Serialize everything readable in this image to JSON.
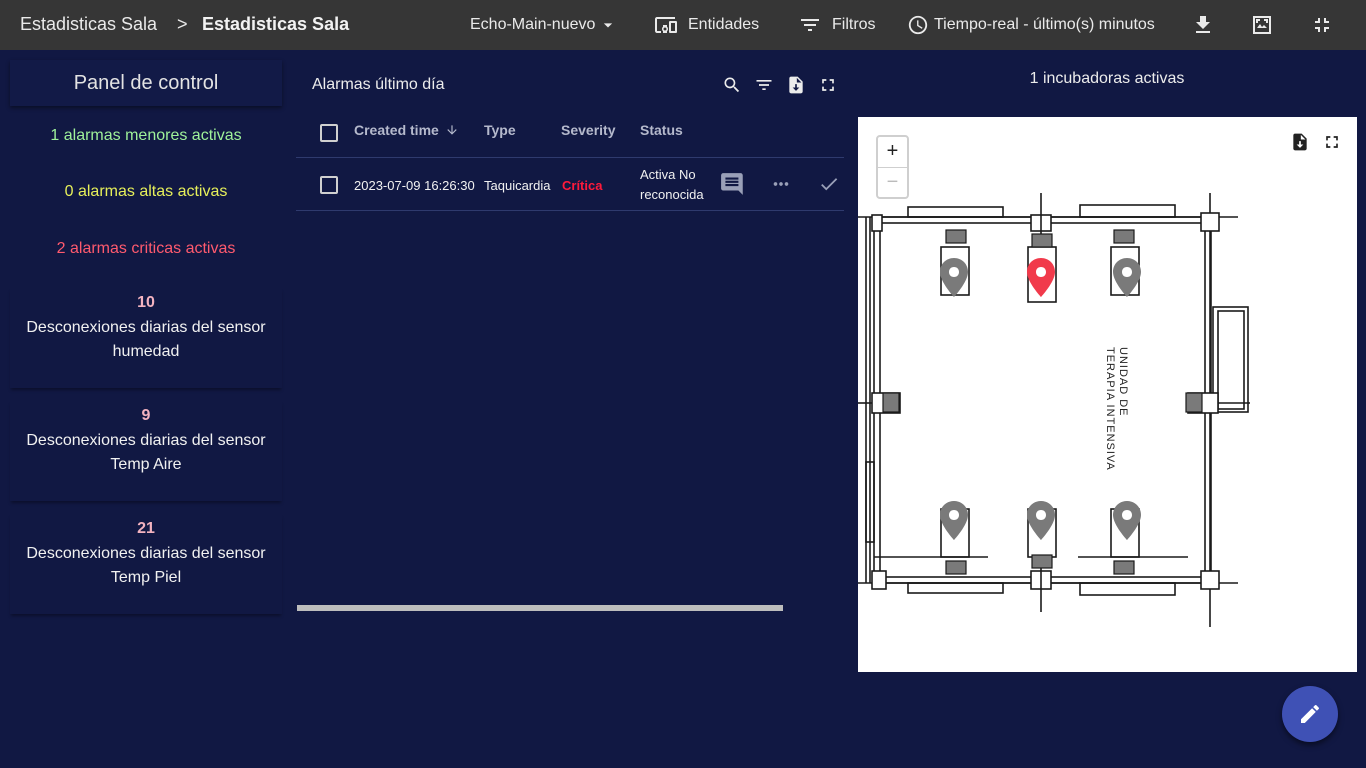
{
  "header": {
    "breadcrumb_root": "Estadisticas Sala",
    "breadcrumb_sep": ">",
    "breadcrumb_current": "Estadisticas Sala",
    "state_label": "Echo-Main-nuevo",
    "entities_label": "Entidades",
    "filters_label": "Filtros",
    "timewindow_label": "Tiempo-real - último(s) minutos"
  },
  "panel": {
    "title": "Panel de control",
    "minor_alarms": "1 alarmas menores activas",
    "high_alarms": "0 alarmas altas activas",
    "critical_alarms": "2 alarmas criticas activas",
    "stats": [
      {
        "value": "10",
        "label": "Desconexiones diarias del sensor humedad"
      },
      {
        "value": "9",
        "label": "Desconexiones diarias del sensor Temp Aire"
      },
      {
        "value": "21",
        "label": "Desconexiones diarias del sensor Temp Piel"
      }
    ]
  },
  "alarms": {
    "title": "Alarmas último día",
    "columns": {
      "created": "Created time",
      "type": "Type",
      "severity": "Severity",
      "status": "Status"
    },
    "rows": [
      {
        "created": "2023-07-09 16:26:30",
        "type": "Taquicardia",
        "severity": "Crítica",
        "status": "Activa No reconocida"
      }
    ]
  },
  "map": {
    "title": "1 incubadoras activas",
    "zoom_in": "+",
    "zoom_out": "−",
    "room_label_1": "UNIDAD DE",
    "room_label_2": "TERAPIA INTENSIVA",
    "marker_colors": {
      "active": "#f13a4b",
      "inactive": "#7a7a7a"
    }
  },
  "colors": {
    "minor": "#9ff29a",
    "high": "#e6ef5a",
    "critical": "#ff5a6e",
    "background": "#111843",
    "topbar": "#363636",
    "fab": "#3f51b5"
  }
}
